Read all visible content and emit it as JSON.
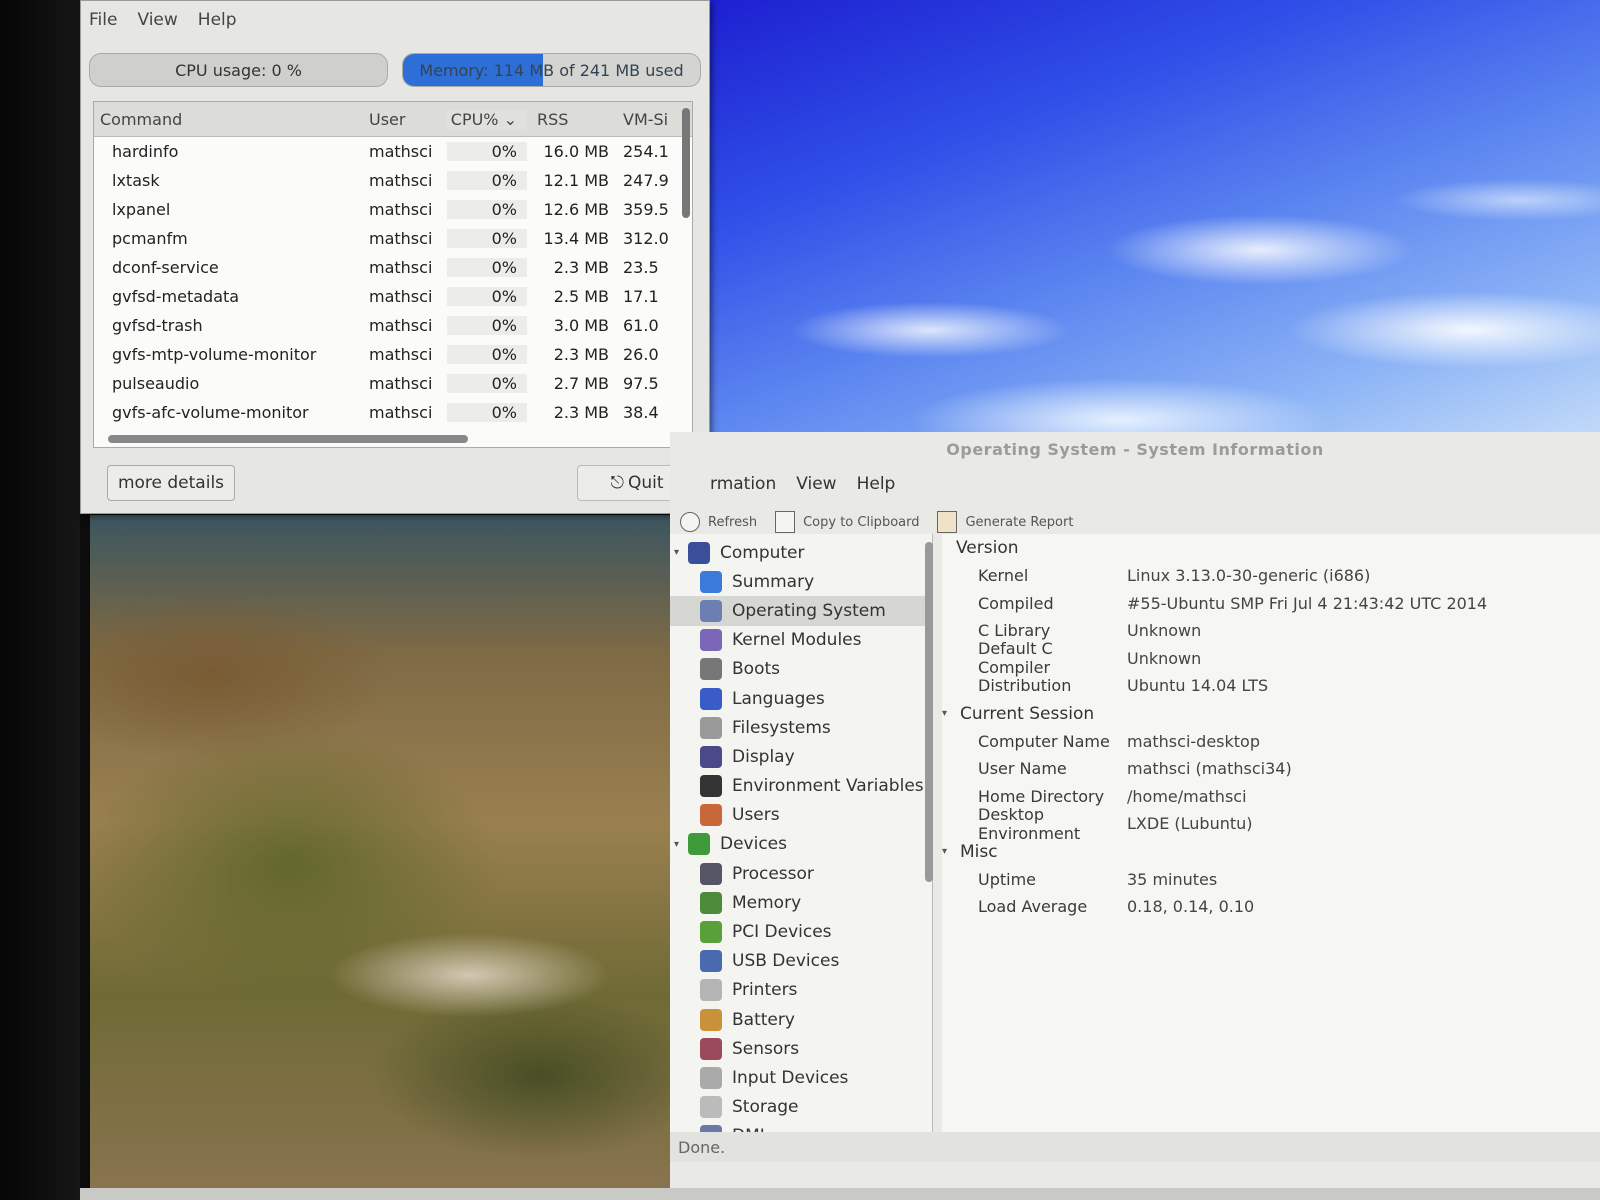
{
  "taskmgr": {
    "menu": [
      "File",
      "View",
      "Help"
    ],
    "cpu_label": "CPU usage: 0 %",
    "cpu_fraction": 0.0,
    "mem_label": "Memory: 114 MB of 241 MB used",
    "mem_fraction": 0.473,
    "columns": {
      "command": "Command",
      "user": "User",
      "cpu": "CPU% ⌄",
      "rss": "RSS",
      "vm": "VM-Si"
    },
    "processes": [
      {
        "command": "hardinfo",
        "user": "mathsci",
        "cpu": "0%",
        "rss": "16.0 MB",
        "vm": "254.1"
      },
      {
        "command": "lxtask",
        "user": "mathsci",
        "cpu": "0%",
        "rss": "12.1 MB",
        "vm": "247.9"
      },
      {
        "command": "lxpanel",
        "user": "mathsci",
        "cpu": "0%",
        "rss": "12.6 MB",
        "vm": "359.5"
      },
      {
        "command": "pcmanfm",
        "user": "mathsci",
        "cpu": "0%",
        "rss": "13.4 MB",
        "vm": "312.0"
      },
      {
        "command": "dconf-service",
        "user": "mathsci",
        "cpu": "0%",
        "rss": "2.3 MB",
        "vm": "23.5"
      },
      {
        "command": "gvfsd-metadata",
        "user": "mathsci",
        "cpu": "0%",
        "rss": "2.5 MB",
        "vm": "17.1"
      },
      {
        "command": "gvfsd-trash",
        "user": "mathsci",
        "cpu": "0%",
        "rss": "3.0 MB",
        "vm": "61.0"
      },
      {
        "command": "gvfs-mtp-volume-monitor",
        "user": "mathsci",
        "cpu": "0%",
        "rss": "2.3 MB",
        "vm": "26.0"
      },
      {
        "command": "pulseaudio",
        "user": "mathsci",
        "cpu": "0%",
        "rss": "2.7 MB",
        "vm": "97.5"
      },
      {
        "command": "gvfs-afc-volume-monitor",
        "user": "mathsci",
        "cpu": "0%",
        "rss": "2.3 MB",
        "vm": "38.4"
      }
    ],
    "more_details": "more details",
    "quit": "Quit"
  },
  "sysinfo": {
    "title": "Operating System - System Information",
    "menu": [
      "rmation",
      "View",
      "Help"
    ],
    "toolbar": {
      "refresh": "Refresh",
      "copy": "Copy to Clipboard",
      "report": "Generate Report"
    },
    "tree": [
      {
        "label": "Computer",
        "level": 0,
        "icon": "computer-icon",
        "color": "#3a4f9a"
      },
      {
        "label": "Summary",
        "level": 1,
        "icon": "info-icon",
        "color": "#3b7ad9"
      },
      {
        "label": "Operating System",
        "level": 1,
        "icon": "gear-icon",
        "color": "#6c7fb3",
        "selected": true
      },
      {
        "label": "Kernel Modules",
        "level": 1,
        "icon": "module-icon",
        "color": "#7b66b8"
      },
      {
        "label": "Boots",
        "level": 1,
        "icon": "power-icon",
        "color": "#777777"
      },
      {
        "label": "Languages",
        "level": 1,
        "icon": "flag-icon",
        "color": "#3a5cc9"
      },
      {
        "label": "Filesystems",
        "level": 1,
        "icon": "drive-icon",
        "color": "#9a9a9a"
      },
      {
        "label": "Display",
        "level": 1,
        "icon": "monitor-icon",
        "color": "#4a4a8a"
      },
      {
        "label": "Environment Variables",
        "level": 1,
        "icon": "terminal-icon",
        "color": "#333333"
      },
      {
        "label": "Users",
        "level": 1,
        "icon": "users-icon",
        "color": "#c8683a"
      },
      {
        "label": "Devices",
        "level": 0,
        "icon": "board-icon",
        "color": "#3f9a3a"
      },
      {
        "label": "Processor",
        "level": 1,
        "icon": "cpu-icon",
        "color": "#555566"
      },
      {
        "label": "Memory",
        "level": 1,
        "icon": "memory-icon",
        "color": "#4d8a3a"
      },
      {
        "label": "PCI Devices",
        "level": 1,
        "icon": "pci-icon",
        "color": "#5aa03a"
      },
      {
        "label": "USB Devices",
        "level": 1,
        "icon": "usb-icon",
        "color": "#4a6ab0"
      },
      {
        "label": "Printers",
        "level": 1,
        "icon": "printer-icon",
        "color": "#b5b5b5"
      },
      {
        "label": "Battery",
        "level": 1,
        "icon": "battery-icon",
        "color": "#c8913a"
      },
      {
        "label": "Sensors",
        "level": 1,
        "icon": "thermometer-icon",
        "color": "#9a4a5a"
      },
      {
        "label": "Input Devices",
        "level": 1,
        "icon": "keyboard-icon",
        "color": "#aaaaaa"
      },
      {
        "label": "Storage",
        "level": 1,
        "icon": "storage-icon",
        "color": "#bbbbbb"
      },
      {
        "label": "DMI",
        "level": 1,
        "icon": "dmi-icon",
        "color": "#6a78a8"
      }
    ],
    "details": {
      "version": {
        "title": "Version",
        "rows": [
          {
            "k": "Kernel",
            "v": "Linux 3.13.0-30-generic (i686)"
          },
          {
            "k": "Compiled",
            "v": "#55-Ubuntu SMP Fri Jul 4 21:43:42 UTC 2014"
          },
          {
            "k": "C Library",
            "v": "Unknown"
          },
          {
            "k": "Default C Compiler",
            "v": "Unknown"
          },
          {
            "k": "Distribution",
            "v": "Ubuntu 14.04 LTS"
          }
        ]
      },
      "session": {
        "title": "Current Session",
        "rows": [
          {
            "k": "Computer Name",
            "v": "mathsci-desktop"
          },
          {
            "k": "User Name",
            "v": "mathsci (mathsci34)"
          },
          {
            "k": "Home Directory",
            "v": "/home/mathsci"
          },
          {
            "k": "Desktop Environment",
            "v": "LXDE (Lubuntu)"
          }
        ]
      },
      "misc": {
        "title": "Misc",
        "rows": [
          {
            "k": "Uptime",
            "v": "35 minutes"
          },
          {
            "k": "Load Average",
            "v": "0.18, 0.14, 0.10"
          }
        ]
      }
    },
    "status": "Done."
  }
}
